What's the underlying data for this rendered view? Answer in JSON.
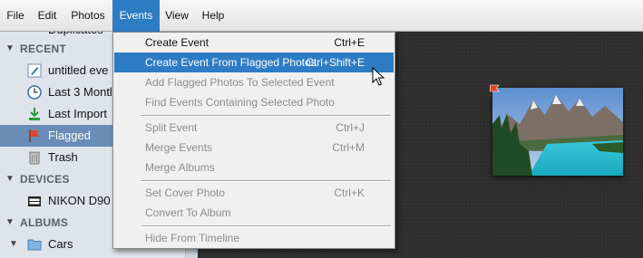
{
  "menubar": {
    "items": [
      "File",
      "Edit",
      "Photos",
      "Events",
      "View",
      "Help"
    ],
    "active": "Events"
  },
  "sidebar": {
    "partial_top": "Duplicates",
    "recent_header": "RECENT",
    "recent": [
      {
        "label": "untitled eve",
        "icon": "edit-icon"
      },
      {
        "label": "Last 3 Montl",
        "icon": "clock-icon"
      },
      {
        "label": "Last Import",
        "icon": "import-icon"
      },
      {
        "label": "Flagged",
        "icon": "flag-icon",
        "selected": true
      },
      {
        "label": "Trash",
        "icon": "trash-icon"
      }
    ],
    "devices_header": "DEVICES",
    "devices": [
      {
        "label": "NIKON D90",
        "icon": "camera-icon"
      }
    ],
    "albums_header": "ALBUMS",
    "albums": [
      {
        "label": "Cars",
        "icon": "folder-icon"
      }
    ]
  },
  "events_menu": {
    "items": [
      {
        "label": "Create Event",
        "shortcut": "Ctrl+E",
        "enabled": true
      },
      {
        "label": "Create Event From Flagged Photos",
        "shortcut": "Ctrl+Shift+E",
        "enabled": true,
        "highlighted": true
      },
      {
        "label": "Add Flagged Photos To Selected Event",
        "shortcut": "",
        "enabled": false
      },
      {
        "label": "Find Events Containing Selected Photo",
        "shortcut": "",
        "enabled": false
      },
      {
        "label": "Split Event",
        "shortcut": "Ctrl+J",
        "enabled": false
      },
      {
        "label": "Merge Events",
        "shortcut": "Ctrl+M",
        "enabled": false
      },
      {
        "label": "Merge Albums",
        "shortcut": "",
        "enabled": false
      },
      {
        "label": "Set Cover Photo",
        "shortcut": "Ctrl+K",
        "enabled": false
      },
      {
        "label": "Convert To Album",
        "shortcut": "",
        "enabled": false
      },
      {
        "label": "Hide From Timeline",
        "shortcut": "",
        "enabled": false
      }
    ]
  },
  "colors": {
    "accent": "#2d7cc4",
    "selected_row": "#6b8cb6",
    "flag": "#e0452b"
  }
}
